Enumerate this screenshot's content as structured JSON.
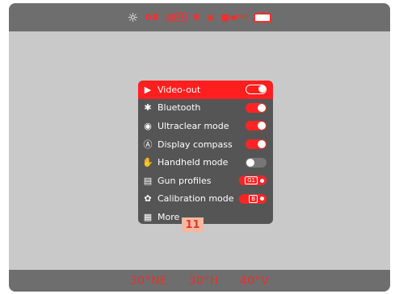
{
  "statusbar": {
    "sun_icon": "☼",
    "calib_label": "B",
    "gun_label": "G1",
    "bluetooth_icon": "✱",
    "eye_icon": "◉",
    "video_out_label": "OUT"
  },
  "menu": {
    "items": [
      {
        "label": "Video-out",
        "icon": "▶",
        "control": "toggle-on",
        "selected": true
      },
      {
        "label": "Bluetooth",
        "icon": "✱",
        "control": "toggle-on"
      },
      {
        "label": "Ultraclear mode",
        "icon": "◉",
        "control": "toggle-on"
      },
      {
        "label": "Display compass",
        "icon": "Ⓐ",
        "control": "toggle-on"
      },
      {
        "label": "Handheld mode",
        "icon": "✋",
        "control": "toggle-off"
      },
      {
        "label": "Gun profiles",
        "icon": "▤",
        "control": "pill",
        "value": "G1"
      },
      {
        "label": "Calibration mode",
        "icon": "✿",
        "control": "pill",
        "value": "B"
      },
      {
        "label": "More",
        "icon": "▦",
        "control": "none"
      }
    ]
  },
  "page_number": "11",
  "bottom": {
    "heading": "30°NE",
    "horizontal": "30°H",
    "vertical": "40°V"
  },
  "colors": {
    "accent": "#ff1f1f",
    "bar": "#6e6e6e",
    "menu_bg": "#555555",
    "screen_bg": "#c9c9c9"
  }
}
